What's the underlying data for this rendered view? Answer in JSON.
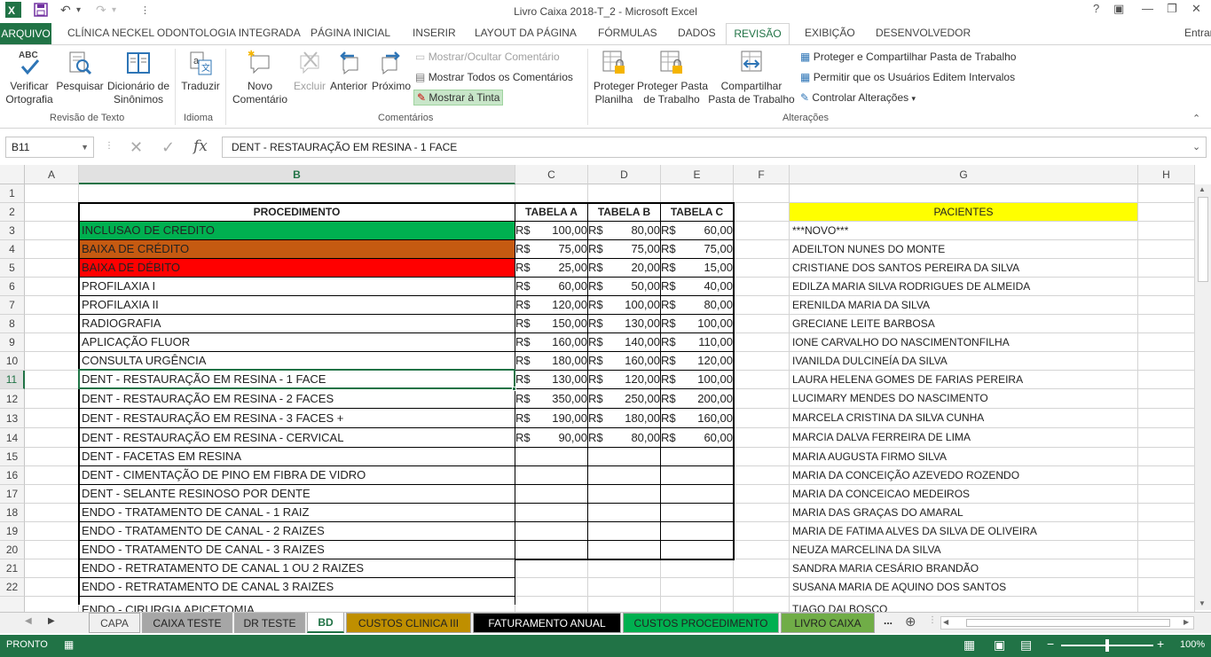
{
  "window": {
    "title": "Livro Caixa 2018-T_2 - Microsoft Excel",
    "help": "?",
    "user": "Entrar"
  },
  "menu": {
    "arquivo": "ARQUIVO",
    "tabs": [
      "CLÍNICA NECKEL ODONTOLOGIA INTEGRADA",
      "PÁGINA INICIAL",
      "INSERIR",
      "LAYOUT DA PÁGINA",
      "FÓRMULAS",
      "DADOS",
      "REVISÃO",
      "EXIBIÇÃO",
      "DESENVOLVEDOR"
    ]
  },
  "ribbon": {
    "verificar": "Verificar\nOrtografia",
    "pesquisar": "Pesquisar",
    "dicionario": "Dicionário de\nSinônimos",
    "traduzir": "Traduzir",
    "novo": "Novo\nComentário",
    "excluir": "Excluir",
    "anterior": "Anterior",
    "proximo": "Próximo",
    "mostrar_ocultar": "Mostrar/Ocultar Comentário",
    "mostrar_todos": "Mostrar Todos os Comentários",
    "mostrar_tinta": "Mostrar à Tinta",
    "proteger_planilha": "Proteger\nPlanilha",
    "proteger_pasta": "Proteger Pasta\nde Trabalho",
    "compartilhar": "Compartilhar\nPasta de Trabalho",
    "proteger_compartilhar": "Proteger e Compartilhar Pasta de Trabalho",
    "permitir": "Permitir que os Usuários Editem Intervalos",
    "controlar": "Controlar Alterações",
    "grp_revisao": "Revisão de Texto",
    "grp_idioma": "Idioma",
    "grp_comentarios": "Comentários",
    "grp_alteracoes": "Alterações",
    "abc": "ABC"
  },
  "formula_bar": {
    "name_box": "B11",
    "fx": "fx",
    "content": "DENT - RESTAURAÇÃO EM RESINA - 1 FACE"
  },
  "columns": [
    "A",
    "B",
    "C",
    "D",
    "E",
    "F",
    "G",
    "H"
  ],
  "rows": [
    "1",
    "2",
    "3",
    "4",
    "5",
    "6",
    "7",
    "8",
    "9",
    "10",
    "11",
    "12",
    "13",
    "14",
    "15",
    "16",
    "17",
    "18",
    "19",
    "20",
    "21",
    "22"
  ],
  "table": {
    "headers": [
      "PROCEDIMENTO",
      "TABELA A",
      "TABELA B",
      "TABELA C"
    ],
    "currency": "R$",
    "procedures": [
      "INCLUSAO DE CREDITO",
      "BAIXA DE CRÉDITO",
      "BAIXA DE DÉBITO",
      "PROFILAXIA I",
      "PROFILAXIA II",
      "RADIOGRAFIA",
      "APLICAÇÃO FLUOR",
      "CONSULTA URGÊNCIA",
      "DENT - RESTAURAÇÃO EM RESINA - 1 FACE",
      "DENT - RESTAURAÇÃO EM RESINA - 2 FACES",
      "DENT - RESTAURAÇÃO EM RESINA - 3 FACES +",
      "DENT - RESTAURAÇÃO EM RESINA - CERVICAL",
      "DENT - FACETAS EM RESINA",
      "DENT - CIMENTAÇÃO DE PINO EM FIBRA DE VIDRO",
      "DENT - SELANTE RESINOSO POR DENTE",
      "ENDO - TRATAMENTO DE CANAL - 1 RAIZ",
      "ENDO - TRATAMENTO DE CANAL - 2 RAIZES",
      "ENDO - TRATAMENTO DE CANAL - 3 RAIZES",
      "ENDO - RETRATAMENTO DE CANAL 1 OU 2 RAIZES",
      "ENDO - RETRATAMENTO DE CANAL 3 RAIZES",
      "ENDO - CIRURGIA APICETOMIA"
    ],
    "a": [
      "100,00",
      "75,00",
      "25,00",
      "60,00",
      "120,00",
      "150,00",
      "160,00",
      "180,00",
      "130,00",
      "350,00",
      "190,00",
      "90,00"
    ],
    "b": [
      "80,00",
      "75,00",
      "20,00",
      "50,00",
      "100,00",
      "130,00",
      "140,00",
      "160,00",
      "120,00",
      "250,00",
      "180,00",
      "80,00"
    ],
    "c": [
      "60,00",
      "75,00",
      "15,00",
      "40,00",
      "80,00",
      "100,00",
      "110,00",
      "120,00",
      "100,00",
      "200,00",
      "160,00",
      "60,00"
    ],
    "row_colors": {
      "0": "#00b050",
      "1": "#c55a11",
      "2": "#ff0000"
    }
  },
  "patients": {
    "header": "PACIENTES",
    "header_color": "#ffff00",
    "names": [
      "***NOVO***",
      "ADEILTON NUNES DO MONTE",
      "CRISTIANE DOS SANTOS PEREIRA DA SILVA",
      "EDILZA MARIA SILVA RODRIGUES DE ALMEIDA",
      "ERENILDA MARIA DA SILVA",
      "GRECIANE LEITE BARBOSA",
      "IONE CARVALHO DO NASCIMENTONFILHA",
      "IVANILDA DULCINEÍA DA SILVA",
      "LAURA HELENA GOMES DE FARIAS PEREIRA",
      "LUCIMARY MENDES DO NASCIMENTO",
      "MARCELA CRISTINA DA SILVA CUNHA",
      "MARCIA DALVA FERREIRA DE LIMA",
      "MARIA AUGUSTA FIRMO SILVA",
      "MARIA DA CONCEIÇÃO AZEVEDO ROZENDO",
      "MARIA DA CONCEICAO MEDEIROS",
      "MARIA DAS GRAÇAS DO AMARAL",
      "MARIA DE FATIMA ALVES DA SILVA DE OLIVEIRA",
      "NEUZA MARCELINA DA SILVA",
      "SANDRA MARIA CESÁRIO BRANDÃO",
      "SUSANA MARIA DE AQUINO DOS SANTOS",
      "TIAGO DALBOSCO"
    ]
  },
  "sheets": [
    {
      "label": "CAPA",
      "bg": "#f0f0f0",
      "color": "#444"
    },
    {
      "label": "CAIXA TESTE",
      "bg": "#a6a6a6",
      "color": "#222"
    },
    {
      "label": "DR TESTE",
      "bg": "#a6a6a6",
      "color": "#222"
    },
    {
      "label": "BD",
      "bg": "#ffffff",
      "color": "#217346"
    },
    {
      "label": "CUSTOS CLINICA III",
      "bg": "#bf8f00",
      "color": "#222"
    },
    {
      "label": "FATURAMENTO ANUAL",
      "bg": "#000000",
      "color": "#ffffff"
    },
    {
      "label": "CUSTOS PROCEDIMENTO",
      "bg": "#00b050",
      "color": "#222"
    },
    {
      "label": "LIVRO CAIXA",
      "bg": "#70ad47",
      "color": "#222"
    }
  ],
  "sheet_more": "...",
  "status": {
    "ready": "PRONTO",
    "zoom": "100%",
    "zoom_level": 1.0
  }
}
